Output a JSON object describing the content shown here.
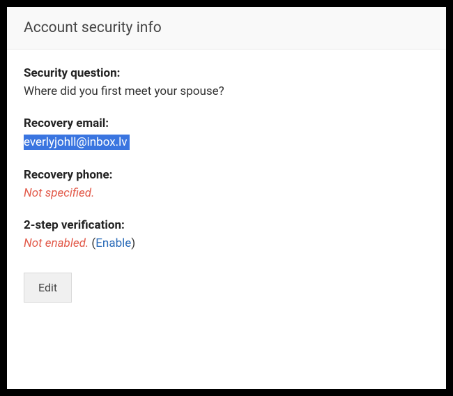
{
  "header": {
    "title": "Account security info"
  },
  "security_question": {
    "label": "Security question:",
    "value": "Where did you first meet your spouse?"
  },
  "recovery_email": {
    "label": "Recovery email:",
    "value": "everlyjohll@inbox.lv"
  },
  "recovery_phone": {
    "label": "Recovery phone:",
    "value": "Not specified."
  },
  "two_step": {
    "label": "2-step verification:",
    "value": "Not enabled.",
    "open_paren": " (",
    "enable_link": "Enable",
    "close_paren": ")"
  },
  "actions": {
    "edit_label": "Edit"
  }
}
